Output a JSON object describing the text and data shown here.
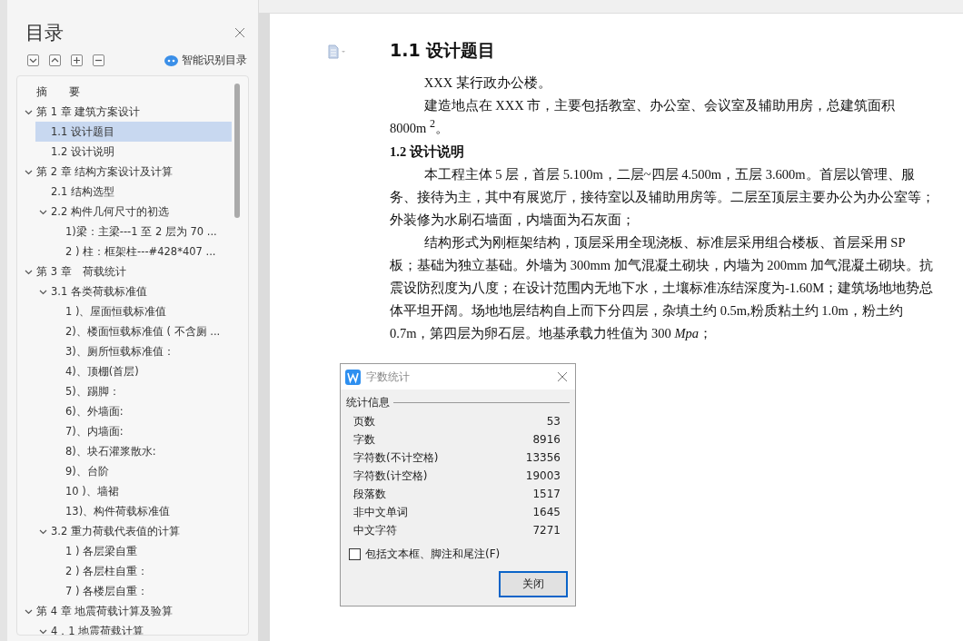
{
  "sidebar": {
    "title": "目录",
    "smart_button": "智能识别目录",
    "toc": [
      {
        "label": "摘　　要",
        "selected": false
      },
      {
        "label": "第 1 章  建筑方案设计",
        "selected": false,
        "expanded": true,
        "children": [
          {
            "label": "1.1 设计题目",
            "selected": true
          },
          {
            "label": "1.2 设计说明",
            "selected": false
          }
        ]
      },
      {
        "label": "第 2 章  结构方案设计及计算",
        "selected": false,
        "expanded": true,
        "children": [
          {
            "label": "2.1 结构选型",
            "selected": false
          },
          {
            "label": "2.2 构件几何尺寸的初选",
            "selected": false,
            "expanded": true,
            "children": [
              {
                "label": "1)梁：主梁---1 至 2 层为 70 ...",
                "selected": false
              },
              {
                "label": "2 ) 柱：框架柱---#428*407 ...",
                "selected": false
              }
            ]
          }
        ]
      },
      {
        "label": "第 3 章　荷载统计",
        "selected": false,
        "expanded": true,
        "children": [
          {
            "label": "3.1 各类荷载标准值",
            "selected": false,
            "expanded": true,
            "children": [
              {
                "label": "1 )、屋面恒载标准值",
                "selected": false
              },
              {
                "label": "2)、楼面恒载标准值 ( 不含厕 ...",
                "selected": false
              },
              {
                "label": "3)、厕所恒载标准值：",
                "selected": false
              },
              {
                "label": "4)、顶棚(首层)",
                "selected": false
              },
              {
                "label": "5)、踢脚：",
                "selected": false
              },
              {
                "label": "6)、外墙面:",
                "selected": false
              },
              {
                "label": "7)、内墙面:",
                "selected": false
              },
              {
                "label": "8)、块石灌浆散水:",
                "selected": false
              },
              {
                "label": "9)、台阶",
                "selected": false
              },
              {
                "label": "10 )、墙裙",
                "selected": false
              },
              {
                "label": "13)、构件荷载标准值",
                "selected": false
              }
            ]
          },
          {
            "label": "3.2 重力荷载代表值的计算",
            "selected": false,
            "expanded": true,
            "children": [
              {
                "label": "1 ) 各层梁自重",
                "selected": false
              },
              {
                "label": "2 ) 各层柱自重：",
                "selected": false
              },
              {
                "label": "7 ) 各楼层自重：",
                "selected": false
              }
            ]
          }
        ]
      },
      {
        "label": "第 4 章  地震荷载计算及验算",
        "selected": false,
        "expanded": true,
        "children": [
          {
            "label": "4．1 地震荷载计算",
            "selected": false,
            "expanded": true
          }
        ]
      }
    ]
  },
  "document": {
    "heading": "1.1 设计题目",
    "blocks": [
      {
        "kind": "para",
        "text": "XXX 某行政办公楼。"
      },
      {
        "kind": "para",
        "text": "建造地点在 XXX 市，主要包括教室、办公室、会议室及辅助用房，总建筑面积 8000m $^{2}$。"
      },
      {
        "kind": "heading",
        "text": "1.2 设计说明"
      },
      {
        "kind": "para",
        "text": "本工程主体 5 层，首层 5.100m，二层~四层 4.500m，五层 3.600m。首层以管理、服务、接待为主，其中有展览厅，接待室以及辅助用房等。二层至顶层主要办公为办公室等；外装修为水刷石墙面，内墙面为石灰面；"
      },
      {
        "kind": "para",
        "text": "结构形式为刚框架结构，顶层采用全现浇板、标准层采用组合楼板、首层采用 SP 板；基础为独立基础。外墙为 300mm 加气混凝土砌块，内墙为 200mm 加气混凝土砌块。抗震设防烈度为八度；在设计范围内无地下水，土壤标准冻结深度为-1.60M；建筑场地地势总体平坦开阔。场地地层结构自上而下分四层，杂填土约 0.5m,粉质粘土约 1.0m，粉土约 0.7m，第四层为卵石层。地基承载力牲值为 300 *Mpa*；"
      }
    ]
  },
  "dialog": {
    "title": "字数统计",
    "section": "统计信息",
    "stats": [
      {
        "label": "页数",
        "value": "53"
      },
      {
        "label": "字数",
        "value": "8916"
      },
      {
        "label": "字符数(不计空格)",
        "value": "13356"
      },
      {
        "label": "字符数(计空格)",
        "value": "19003"
      },
      {
        "label": "段落数",
        "value": "1517"
      },
      {
        "label": "非中文单词",
        "value": "1645"
      },
      {
        "label": "中文字符",
        "value": "7271"
      }
    ],
    "checkbox": {
      "label": "包括文本框、脚注和尾注(F)",
      "checked": false
    },
    "close_button": "关闭"
  }
}
